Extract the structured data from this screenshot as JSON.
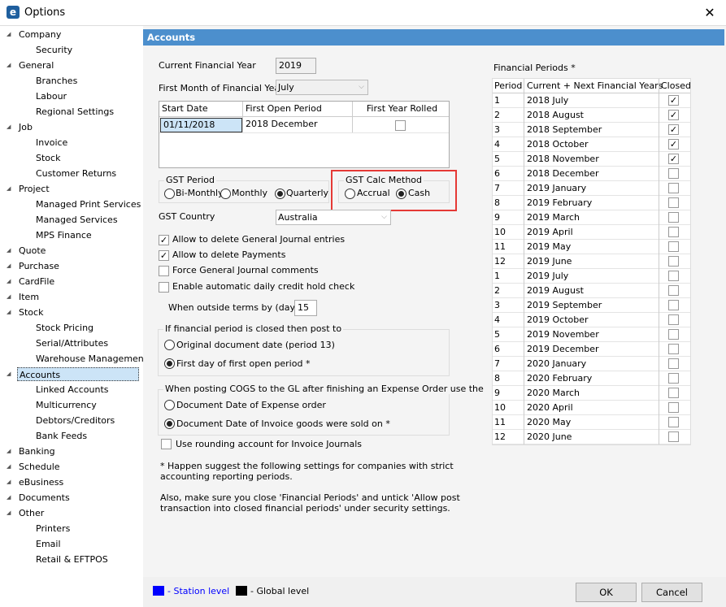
{
  "window": {
    "title": "Options",
    "close": "✕"
  },
  "sidebar": {
    "items": [
      {
        "label": "Company",
        "level": 0
      },
      {
        "label": "Security",
        "level": 1
      },
      {
        "label": "General",
        "level": 0
      },
      {
        "label": "Branches",
        "level": 1
      },
      {
        "label": "Labour",
        "level": 1
      },
      {
        "label": "Regional Settings",
        "level": 1
      },
      {
        "label": "Job",
        "level": 0
      },
      {
        "label": "Invoice",
        "level": 1
      },
      {
        "label": "Stock",
        "level": 1
      },
      {
        "label": "Customer Returns",
        "level": 1
      },
      {
        "label": "Project",
        "level": 0
      },
      {
        "label": "Managed Print Services",
        "level": 1
      },
      {
        "label": "Managed Services",
        "level": 1
      },
      {
        "label": "MPS Finance",
        "level": 1
      },
      {
        "label": "Quote",
        "level": 0
      },
      {
        "label": "Purchase",
        "level": 0
      },
      {
        "label": "CardFile",
        "level": 0
      },
      {
        "label": "Item",
        "level": 0
      },
      {
        "label": "Stock",
        "level": 0
      },
      {
        "label": "Stock Pricing",
        "level": 1
      },
      {
        "label": "Serial/Attributes",
        "level": 1
      },
      {
        "label": "Warehouse Management",
        "level": 1
      },
      {
        "label": "Accounts",
        "level": 0,
        "selected": true
      },
      {
        "label": "Linked Accounts",
        "level": 1
      },
      {
        "label": "Multicurrency",
        "level": 1
      },
      {
        "label": "Debtors/Creditors",
        "level": 1
      },
      {
        "label": "Bank Feeds",
        "level": 1
      },
      {
        "label": "Banking",
        "level": 0
      },
      {
        "label": "Schedule",
        "level": 0
      },
      {
        "label": "eBusiness",
        "level": 0
      },
      {
        "label": "Documents",
        "level": 0
      },
      {
        "label": "Other",
        "level": 0
      },
      {
        "label": "Printers",
        "level": 1
      },
      {
        "label": "Email",
        "level": 1
      },
      {
        "label": "Retail & EFTPOS",
        "level": 1
      }
    ]
  },
  "header": {
    "title": "Accounts"
  },
  "form": {
    "current_year_label": "Current Financial Year",
    "current_year": "2019",
    "first_month_label": "First Month of Financial Year",
    "first_month": "July",
    "grid": {
      "headers": [
        "Start Date",
        "First Open Period",
        "First Year Rolled"
      ],
      "start_date": "01/11/2018",
      "first_open": "2018 December",
      "rolled": false
    },
    "gst_period": {
      "label": "GST Period",
      "options": [
        "Bi-Monthly",
        "Monthly",
        "Quarterly"
      ],
      "selected": "Quarterly"
    },
    "gst_calc": {
      "label": "GST Calc Method",
      "options": [
        "Accrual",
        "Cash"
      ],
      "selected": "Cash",
      "highlight_color": "#e53935"
    },
    "gst_country_label": "GST Country",
    "gst_country": "Australia",
    "checks": [
      {
        "label": "Allow to delete General Journal entries",
        "checked": true
      },
      {
        "label": "Allow to delete Payments",
        "checked": true
      },
      {
        "label": "Force General Journal comments",
        "checked": false
      },
      {
        "label": "Enable automatic daily credit hold check",
        "checked": false
      }
    ],
    "outside_terms_label": "When outside terms by (days)",
    "outside_terms": "15",
    "closed_period": {
      "label": "If financial period is closed then post to",
      "options": [
        "Original document date (period 13)",
        "First day of first open period *"
      ],
      "selected": 1
    },
    "cogs": {
      "label": "When posting COGS to the GL after finishing an Expense Order use the",
      "options": [
        "Document Date of Expense order",
        "Document Date of Invoice goods were sold on *"
      ],
      "selected": 1
    },
    "rounding": {
      "label": "Use rounding account for Invoice Journals",
      "checked": false
    },
    "note1": "* Happen suggest the following settings for companies with strict accounting reporting periods.",
    "note2": "Also, make sure you close 'Financial Periods' and untick 'Allow post transaction into closed financial periods' under security settings."
  },
  "periods": {
    "title": "Financial Periods *",
    "headers": [
      "Period",
      "Current + Next Financial Years",
      "Closed"
    ],
    "rows": [
      [
        "1",
        "2018 July",
        true
      ],
      [
        "2",
        "2018 August",
        true
      ],
      [
        "3",
        "2018 September",
        true
      ],
      [
        "4",
        "2018 October",
        true
      ],
      [
        "5",
        "2018 November",
        true
      ],
      [
        "6",
        "2018 December",
        false
      ],
      [
        "7",
        "2019 January",
        false
      ],
      [
        "8",
        "2019 February",
        false
      ],
      [
        "9",
        "2019 March",
        false
      ],
      [
        "10",
        "2019 April",
        false
      ],
      [
        "11",
        "2019 May",
        false
      ],
      [
        "12",
        "2019 June",
        false
      ],
      [
        "1",
        "2019 July",
        false
      ],
      [
        "2",
        "2019 August",
        false
      ],
      [
        "3",
        "2019 September",
        false
      ],
      [
        "4",
        "2019 October",
        false
      ],
      [
        "5",
        "2019 November",
        false
      ],
      [
        "6",
        "2019 December",
        false
      ],
      [
        "7",
        "2020 January",
        false
      ],
      [
        "8",
        "2020 February",
        false
      ],
      [
        "9",
        "2020 March",
        false
      ],
      [
        "10",
        "2020 April",
        false
      ],
      [
        "11",
        "2020 May",
        false
      ],
      [
        "12",
        "2020 June",
        false
      ]
    ]
  },
  "footer": {
    "station_label": "- Station level",
    "station_color": "#0000ff",
    "global_label": "- Global level",
    "global_color": "#000000",
    "ok": "OK",
    "cancel": "Cancel"
  }
}
